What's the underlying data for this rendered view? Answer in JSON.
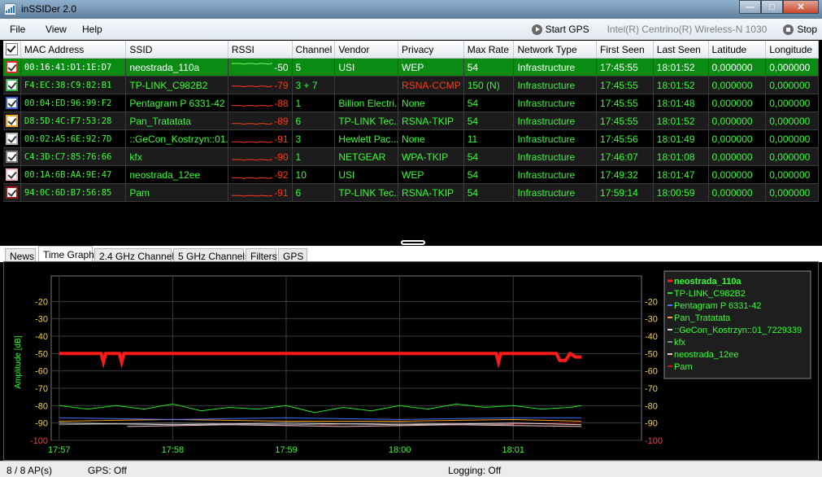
{
  "window": {
    "title": "inSSIDer 2.0"
  },
  "window_controls": {
    "minimize": "—",
    "maximize": "□",
    "close": "✕"
  },
  "menu": {
    "file": "File",
    "view": "View",
    "help": "Help"
  },
  "toolbar": {
    "start_gps": "Start GPS",
    "adapter": "Intel(R) Centrino(R) Wireless-N 1030",
    "stop": "Stop"
  },
  "table": {
    "headers": [
      "MAC Address",
      "SSID",
      "RSSI",
      "Channel",
      "Vendor",
      "Privacy",
      "Max Rate",
      "Network Type",
      "First Seen",
      "Last Seen",
      "Latitude",
      "Longitude"
    ],
    "rows": [
      {
        "mac": "00:16:41:D1:1E:D7",
        "ssid": "neostrada_110a",
        "rssi": "-50",
        "channel": "5",
        "vendor": "USI",
        "privacy": "WEP",
        "max_rate": "54",
        "network_type": "Infrastructure",
        "first_seen": "17:45:55",
        "last_seen": "18:01:52",
        "latitude": "0,000000",
        "longitude": "0,000000",
        "check_color": "#e8262a",
        "signal_level": -50
      },
      {
        "mac": "F4:EC:38:C9:82:B1",
        "ssid": "TP-LINK_C982B2",
        "rssi": "-79",
        "channel": "3 + 7",
        "vendor": "",
        "privacy": "RSNA-CCMP",
        "max_rate": "150 (N)",
        "network_type": "Infrastructure",
        "first_seen": "17:45:55",
        "last_seen": "18:01:52",
        "latitude": "0,000000",
        "longitude": "0,000000",
        "check_color": "#2db34a",
        "signal_level": -79
      },
      {
        "mac": "00:04:ED:96:99:F2",
        "ssid": "Pentagram P 6331-42",
        "rssi": "-88",
        "channel": "1",
        "vendor": "Billion Electri...",
        "privacy": "None",
        "max_rate": "54",
        "network_type": "Infrastructure",
        "first_seen": "17:45:55",
        "last_seen": "18:01:48",
        "latitude": "0,000000",
        "longitude": "0,000000",
        "check_color": "#3a5fd8",
        "signal_level": -88
      },
      {
        "mac": "D8:5D:4C:F7:53:28",
        "ssid": "Pan_Tratatata",
        "rssi": "-89",
        "channel": "6",
        "vendor": "TP-LINK Tec...",
        "privacy": "RSNA-TKIP",
        "max_rate": "54",
        "network_type": "Infrastructure",
        "first_seen": "17:45:55",
        "last_seen": "18:01:52",
        "latitude": "0,000000",
        "longitude": "0,000000",
        "check_color": "#f0a020",
        "signal_level": -89
      },
      {
        "mac": "00:02:A5:6E:92:7D",
        "ssid": "::GeCon_Kostrzyn::01...",
        "rssi": "-91",
        "channel": "3",
        "vendor": "Hewlett Pac...",
        "privacy": "None",
        "max_rate": "11",
        "network_type": "Infrastructure",
        "first_seen": "17:45:56",
        "last_seen": "18:01:49",
        "latitude": "0,000000",
        "longitude": "0,000000",
        "check_color": "#b0b0b0",
        "signal_level": -91
      },
      {
        "mac": "C4:3D:C7:85:76:66",
        "ssid": "kfx",
        "rssi": "-90",
        "channel": "1",
        "vendor": "NETGEAR",
        "privacy": "WPA-TKIP",
        "max_rate": "54",
        "network_type": "Infrastructure",
        "first_seen": "17:46:07",
        "last_seen": "18:01:08",
        "latitude": "0,000000",
        "longitude": "0,000000",
        "check_color": "#7a7a7a",
        "signal_level": -90
      },
      {
        "mac": "00:1A:6B:AA:9E:47",
        "ssid": "neostrada_12ee",
        "rssi": "-92",
        "channel": "10",
        "vendor": "USI",
        "privacy": "WEP",
        "max_rate": "54",
        "network_type": "Infrastructure",
        "first_seen": "17:49:32",
        "last_seen": "18:01:47",
        "latitude": "0,000000",
        "longitude": "0,000000",
        "check_color": "#f4b8bc",
        "signal_level": -92
      },
      {
        "mac": "94:0C:6D:B7:56:85",
        "ssid": "Pam",
        "rssi": "-91",
        "channel": "6",
        "vendor": "TP-LINK Tec...",
        "privacy": "RSNA-TKIP",
        "max_rate": "54",
        "network_type": "Infrastructure",
        "first_seen": "17:59:14",
        "last_seen": "18:00:59",
        "latitude": "0,000000",
        "longitude": "0,000000",
        "check_color": "#a01818",
        "signal_level": -91
      }
    ]
  },
  "tabs": [
    "News",
    "Time Graph",
    "2.4 GHz Channels",
    "5 GHz Channels",
    "Filters",
    "GPS"
  ],
  "active_tab": "Time Graph",
  "chart_data": {
    "type": "line",
    "ylabel": "Amplitude [dB]",
    "ylim": [
      -100,
      -10
    ],
    "yticks": [
      -20,
      -30,
      -40,
      -50,
      -60,
      -70,
      -80,
      -90,
      -100
    ],
    "x_ticks": [
      "17:57",
      "17:58",
      "17:59",
      "18:00",
      "18:01"
    ],
    "x_range_minutes": [
      0,
      5.2
    ],
    "grid": true,
    "legend_position": "top-right",
    "series": [
      {
        "name": "neostrada_110a",
        "color": "#ff1a1a",
        "bold": true,
        "x": [
          0,
          0.37,
          0.39,
          0.41,
          0.53,
          0.55,
          0.57,
          3.85,
          3.87,
          3.89,
          4.38,
          4.41,
          4.46,
          4.5,
          4.55,
          4.6
        ],
        "values": [
          -50,
          -50,
          -55,
          -50,
          -50,
          -55,
          -50,
          -50,
          -55,
          -50,
          -50,
          -54,
          -54,
          -50,
          -52,
          -52
        ]
      },
      {
        "name": "TP-LINK_C982B2",
        "color": "#28e028",
        "x": [
          0,
          0.25,
          0.5,
          0.75,
          1.0,
          1.25,
          1.5,
          1.75,
          2.0,
          2.25,
          2.5,
          2.75,
          3.0,
          3.25,
          3.5,
          3.75,
          4.0,
          4.25,
          4.5,
          4.6
        ],
        "values": [
          -80,
          -82,
          -80,
          -82,
          -79,
          -83,
          -81,
          -82,
          -80,
          -84,
          -81,
          -83,
          -80,
          -82,
          -79,
          -81,
          -80,
          -82,
          -81,
          -80
        ]
      },
      {
        "name": "Pentagram P 6331-42",
        "color": "#4a6fff",
        "x": [
          0,
          1,
          2,
          3,
          4,
          4.6
        ],
        "values": [
          -87,
          -88,
          -87,
          -88,
          -87,
          -87
        ]
      },
      {
        "name": "Pan_Tratatata",
        "color": "#ffa020",
        "x": [
          0,
          1,
          2,
          3,
          4,
          4.6
        ],
        "values": [
          -89,
          -88,
          -89,
          -89,
          -88,
          -89
        ]
      },
      {
        "name": "::GeCon_Kostrzyn::01_7229339",
        "color": "#d8d8d8",
        "x": [
          0,
          1,
          2,
          3,
          4,
          4.6
        ],
        "values": [
          -90,
          -91,
          -90,
          -91,
          -90,
          -91
        ]
      },
      {
        "name": "kfx",
        "color": "#8a8a8a",
        "x": [
          0,
          1,
          2,
          3,
          4,
          4.0
        ],
        "values": [
          -91,
          -90,
          -91,
          -90,
          -91,
          -90
        ]
      },
      {
        "name": "neostrada_12ee",
        "color": "#ffc4c8",
        "x": [
          0.6,
          1.5,
          2.5,
          3.5,
          4.6
        ],
        "values": [
          -92,
          -91,
          -92,
          -91,
          -92
        ]
      },
      {
        "name": "Pam",
        "color": "#c01818",
        "x": [
          2.3,
          3,
          3.5,
          4.6
        ],
        "values": [
          -91,
          -90,
          -91,
          -90
        ]
      }
    ]
  },
  "status": {
    "ap_count": "8 / 8 AP(s)",
    "gps": "GPS: Off",
    "logging": "Logging: Off"
  }
}
